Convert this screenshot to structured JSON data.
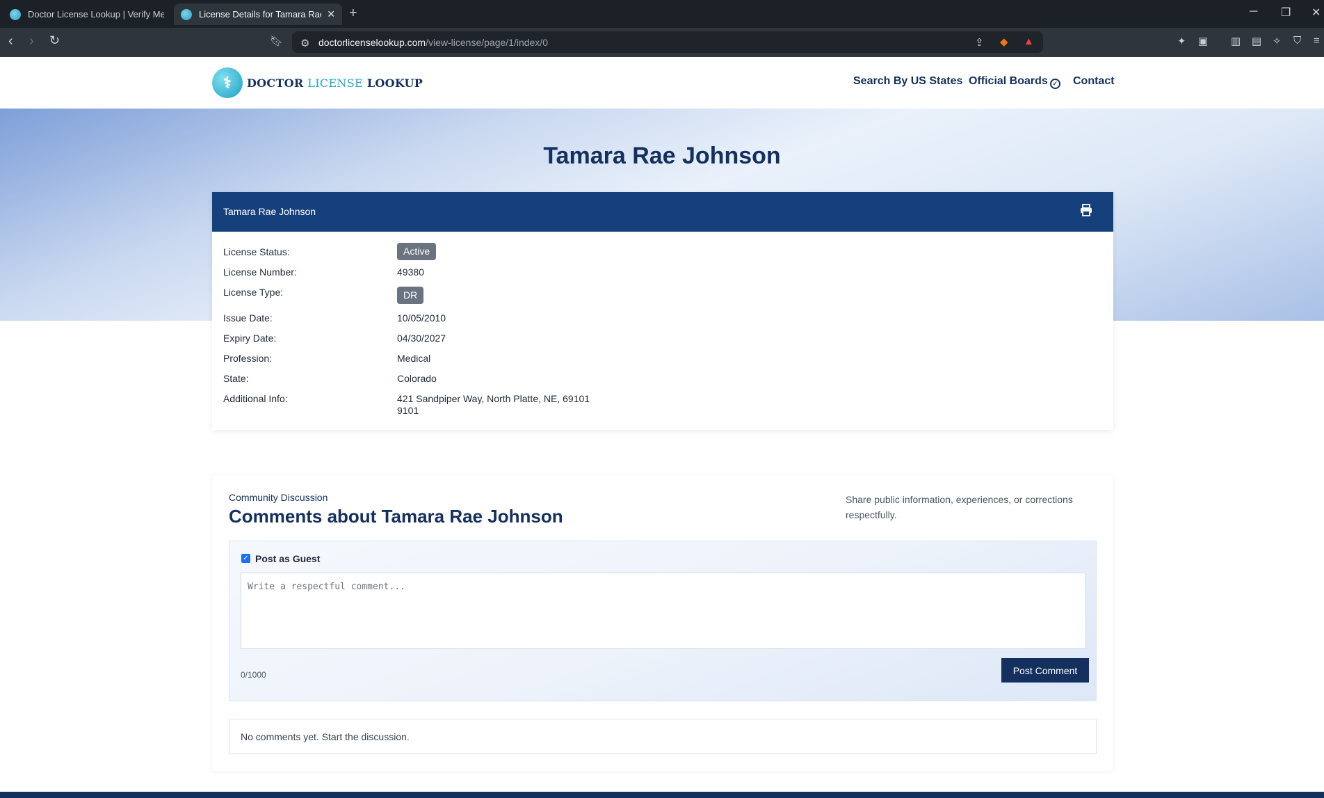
{
  "browser": {
    "tabs": [
      {
        "label": "Doctor License Lookup | Verify Medic",
        "active": false
      },
      {
        "label": "License Details for Tamara Rae Jo",
        "active": true
      }
    ],
    "url_host": "doctorlicenselookup.com",
    "url_path": "/view-license/page/1/index/0"
  },
  "site": {
    "logo": {
      "part1": "DOCTOR",
      "part2": "LICENSE",
      "part3": "LOOKUP"
    },
    "nav": {
      "search_states": "Search By US States",
      "official_boards": "Official Boards",
      "contact": "Contact"
    }
  },
  "page": {
    "title": "Tamara Rae Johnson"
  },
  "license": {
    "header_name": "Tamara Rae Johnson",
    "labels": {
      "status": "License Status:",
      "number": "License Number:",
      "type": "License Type:",
      "issue": "Issue Date:",
      "expiry": "Expiry Date:",
      "profession": "Profession:",
      "state": "State:",
      "additional": "Additional Info:"
    },
    "values": {
      "status": "Active",
      "number": "49380",
      "type": "DR",
      "issue": "10/05/2010",
      "expiry": "04/30/2027",
      "profession": "Medical",
      "state": "Colorado",
      "additional_line1": "421 Sandpiper Way, North Platte, NE, 69101",
      "additional_line2": "9101"
    }
  },
  "comments": {
    "eyebrow": "Community Discussion",
    "title": "Comments about Tamara Rae Johnson",
    "note": "Share public information, experiences, or corrections respectfully.",
    "guest_label": "Post as Guest",
    "guest_checked": true,
    "placeholder": "Write a respectful comment...",
    "counter": "0/1000",
    "post_button": "Post Comment",
    "empty_text": "No comments yet. Start the discussion."
  },
  "colors": {
    "brand": "#14305e",
    "accent": "#1ea8c7",
    "badge": "#6b7280"
  }
}
